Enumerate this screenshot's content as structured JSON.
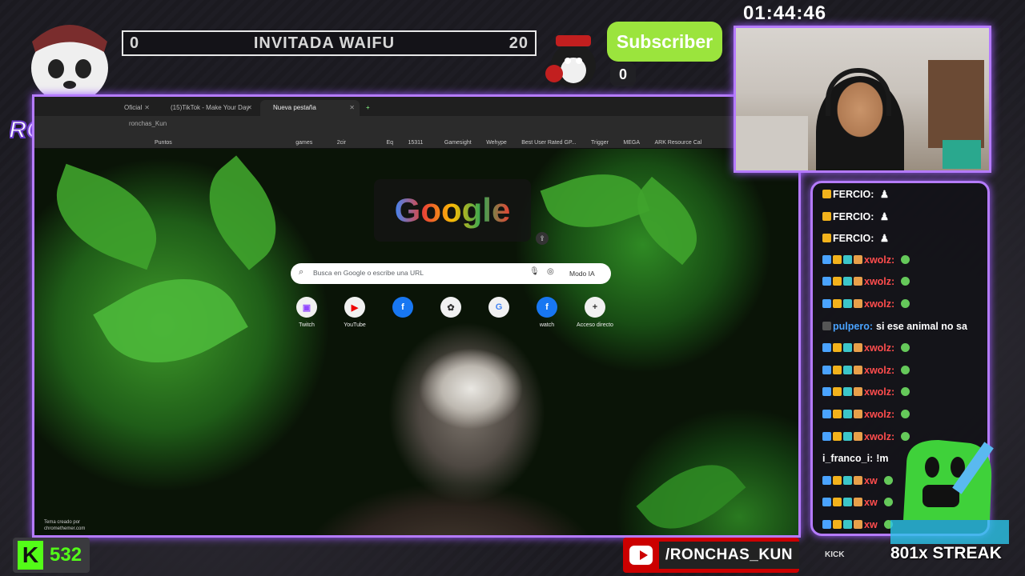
{
  "header": {
    "score_left": "0",
    "title": "INVITADA WAIFU",
    "score_right": "20",
    "subscriber_label": "Subscriber",
    "subscriber_count": "0",
    "clock": "01:44:46"
  },
  "logo": {
    "text": "RONCHAS"
  },
  "browser": {
    "tabs": [
      {
        "label": "Oficial"
      },
      {
        "label": "(15)TikTok - Make Your Day"
      },
      {
        "label": "Nueva pestaña"
      }
    ],
    "address": "ronchas_Kun",
    "bookmarks": [
      "Puntos",
      "games",
      "2cir",
      "Eq",
      "15311",
      "Gamesight",
      "Wehype",
      "Best User Rated GP...",
      "Trigger",
      "MEGA",
      "ARK Resource Cal"
    ],
    "google_logo": "Google",
    "search_placeholder": "Busca en Google o escribe una URL",
    "ai_mode": "Modo IA",
    "shortcuts": [
      {
        "label": "Twitch",
        "icon": "twitch-icon"
      },
      {
        "label": "YouTube",
        "icon": "youtube-icon"
      },
      {
        "label": "",
        "icon": "facebook-icon"
      },
      {
        "label": "",
        "icon": "mascot-icon"
      },
      {
        "label": "",
        "icon": "translate-icon"
      },
      {
        "label": "watch",
        "icon": "facebook-icon"
      },
      {
        "label": "Acceso directo",
        "icon": "add-icon"
      }
    ],
    "credit": [
      "Tema creado por",
      "chromethemer.com"
    ]
  },
  "chat": {
    "messages": [
      {
        "user": "FERCIO:",
        "text": "",
        "type": "ferc"
      },
      {
        "user": "FERCIO:",
        "text": "",
        "type": "ferc"
      },
      {
        "user": "FERCIO:",
        "text": "",
        "type": "ferc"
      },
      {
        "user": "xwolz:",
        "text": "",
        "type": "xw"
      },
      {
        "user": "xwolz:",
        "text": "",
        "type": "xw"
      },
      {
        "user": "xwolz:",
        "text": "",
        "type": "xw"
      },
      {
        "user": "pulpero:",
        "text": "si ese animal no sa",
        "type": "pul"
      },
      {
        "user": "xwolz:",
        "text": "",
        "type": "xw"
      },
      {
        "user": "xwolz:",
        "text": "",
        "type": "xw"
      },
      {
        "user": "xwolz:",
        "text": "",
        "type": "xw"
      },
      {
        "user": "xwolz:",
        "text": "",
        "type": "xw"
      },
      {
        "user": "xwolz:",
        "text": "",
        "type": "xw"
      },
      {
        "user": "i_franco_i:",
        "text": "!m",
        "type": "fr"
      },
      {
        "user": "xw",
        "text": "",
        "type": "xw"
      },
      {
        "user": "xw",
        "text": "",
        "type": "xw"
      },
      {
        "user": "xw",
        "text": "",
        "type": "xw"
      }
    ]
  },
  "footer": {
    "kick_count": "532",
    "youtube_handle": "/RONCHAS_KUN",
    "social_text": "KICK",
    "streak": "801x STREAK"
  },
  "colors": {
    "accent": "#b57bff",
    "kick_green": "#53fc18",
    "subscriber_green": "#9be43d"
  }
}
